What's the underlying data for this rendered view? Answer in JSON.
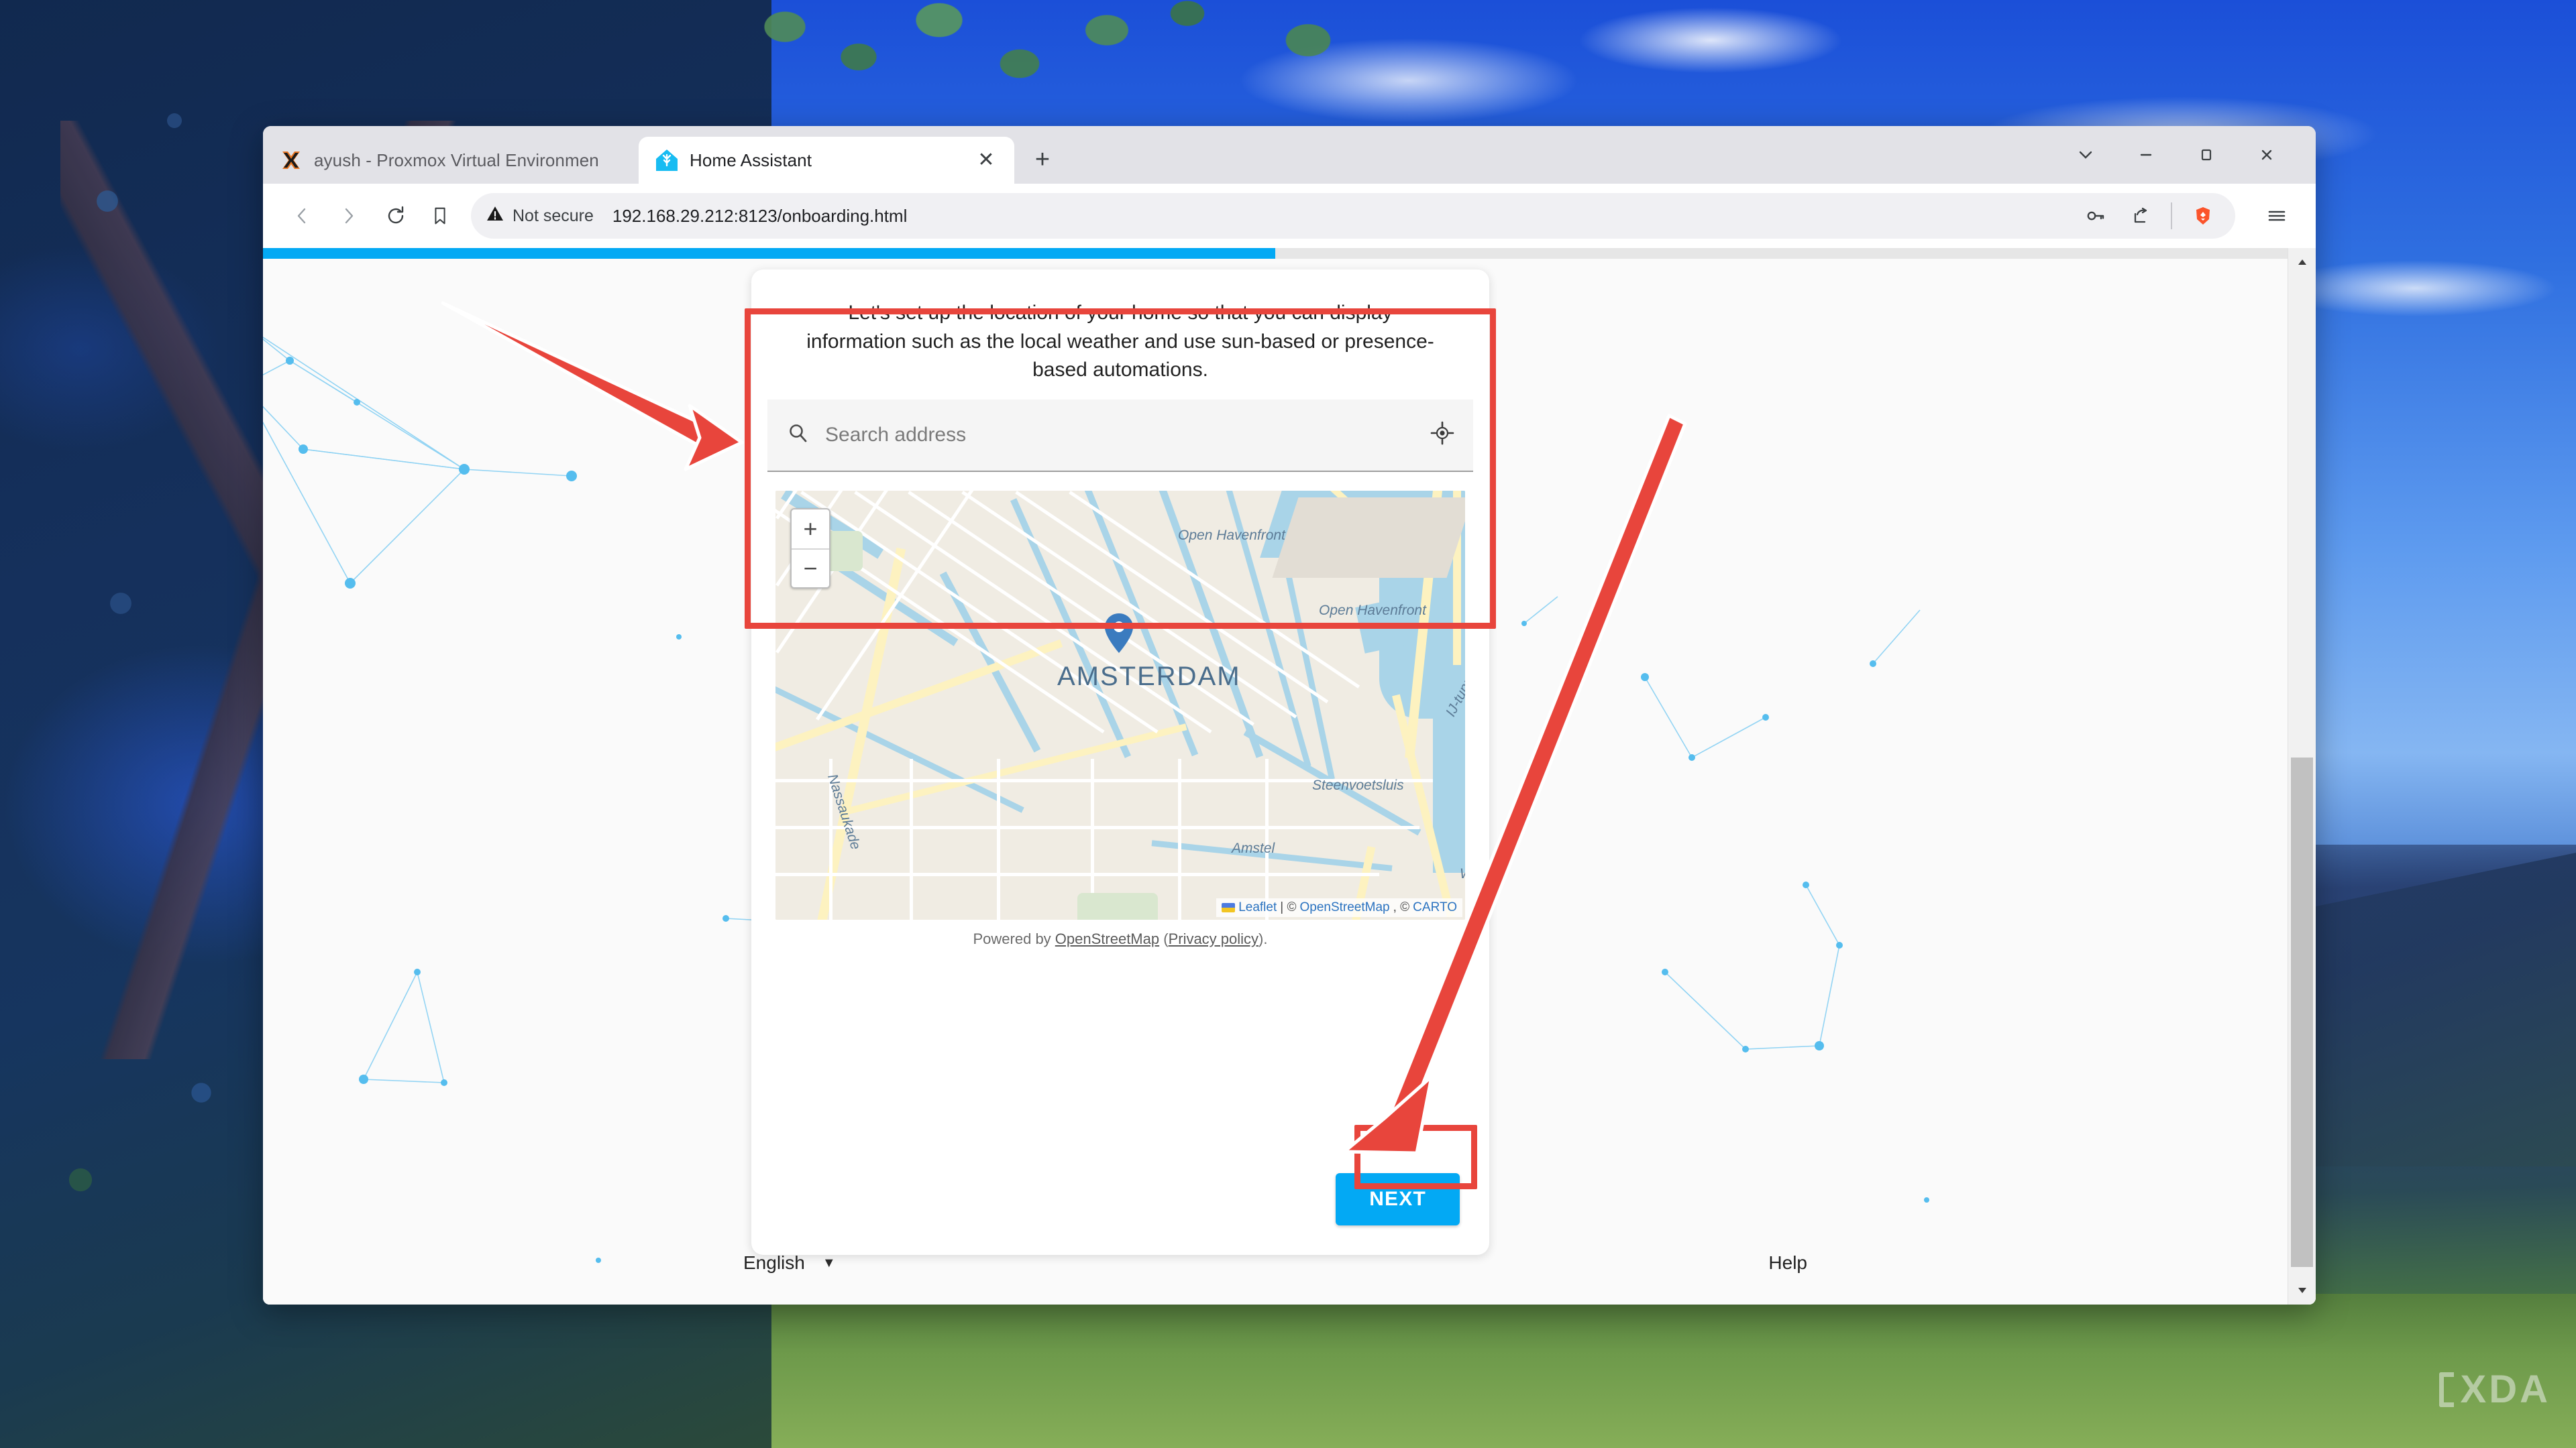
{
  "browser": {
    "tabs": [
      {
        "title": "ayush - Proxmox Virtual Environmen",
        "favicon": "proxmox-icon",
        "active": false
      },
      {
        "title": "Home Assistant",
        "favicon": "home-assistant-icon",
        "active": true
      }
    ],
    "new_tab_label": "+",
    "window_controls": {
      "chevron": "∨",
      "minimize": "—",
      "maximize": "□",
      "close": "✕"
    },
    "toolbar": {
      "back": "‹",
      "forward": "›",
      "reload": "reload-icon",
      "bookmark": "bookmark-icon",
      "security_label": "Not secure",
      "url": "192.168.29.212:8123/onboarding.html",
      "password_manager": "key-icon",
      "share": "share-icon",
      "brave_shields": "brave-lion-icon",
      "menu": "hamburger-menu-icon"
    }
  },
  "page": {
    "progress_percent": 50,
    "accent_color": "#03a9f4",
    "card": {
      "intro_line_1": "Let's set up the location of your home so that you can display information such as",
      "intro_line_2": "the local weather and use sun-based or presence-based automations.",
      "search": {
        "placeholder": "Search address",
        "value": "",
        "search_icon": "search-icon",
        "locate_icon": "crosshair-locate-icon"
      },
      "map": {
        "zoom_in": "+",
        "zoom_out": "−",
        "city_label": "AMSTERDAM",
        "labels": [
          "Open Havenfront",
          "Open Havenfront",
          "Nassaukade",
          "Steenvoetsluis",
          "Amstel",
          "IJ-tunnel",
          "tunnel",
          "Wat"
        ],
        "attribution_prefix": "Leaflet",
        "attribution_sep1": " | © ",
        "attribution_osm": "OpenStreetMap",
        "attribution_sep2": ", © ",
        "attribution_carto": "CARTO"
      },
      "powered_by_prefix": "Powered by ",
      "powered_by_link": "OpenStreetMap",
      "powered_by_mid": " (",
      "privacy_policy_link": "Privacy policy",
      "powered_by_suffix": ").",
      "next_label": "NEXT"
    },
    "footer": {
      "language": "English",
      "language_caret": "▼",
      "help": "Help"
    }
  },
  "annotations": {
    "highlight_color": "#e8453c",
    "boxes": [
      {
        "target": "search-and-map-region"
      },
      {
        "target": "next-button"
      }
    ],
    "arrows": [
      {
        "from": "upper-left",
        "to": "search-address-field"
      },
      {
        "from": "lower-right",
        "to": "next-button"
      }
    ]
  },
  "desktop": {
    "watermark": "XDA"
  }
}
